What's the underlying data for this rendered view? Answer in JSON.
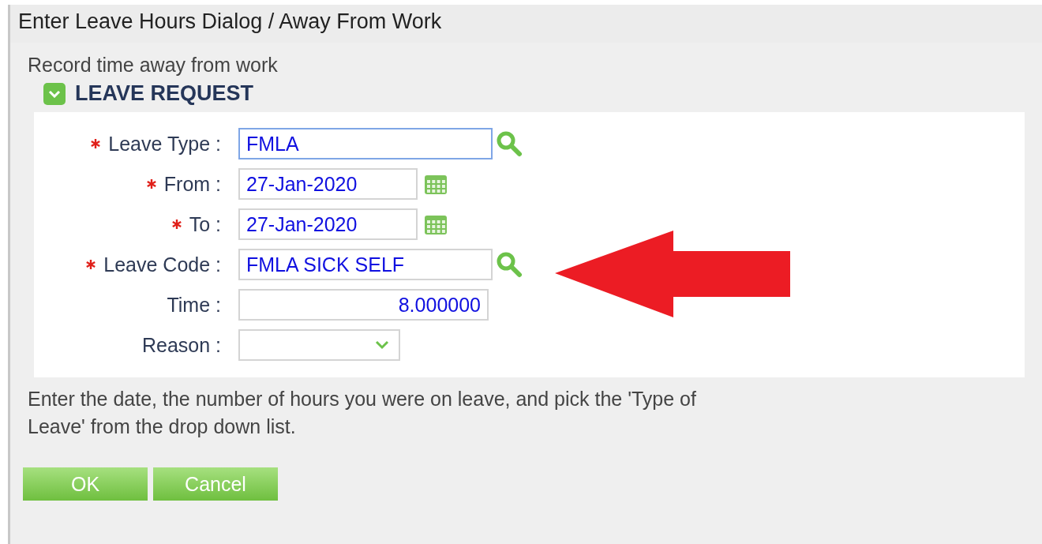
{
  "window": {
    "title": "Enter Leave Hours Dialog / Away From Work"
  },
  "subtitle": "Record time away from work",
  "section": {
    "title": "LEAVE REQUEST",
    "expanded": true
  },
  "fields": [
    {
      "label": "Leave Type :",
      "value": "FMLA",
      "required": true,
      "kind": "lookup",
      "focused": true
    },
    {
      "label": "From :",
      "value": "27-Jan-2020",
      "required": true,
      "kind": "date",
      "focused": false
    },
    {
      "label": "To :",
      "value": "27-Jan-2020",
      "required": true,
      "kind": "date",
      "focused": false
    },
    {
      "label": "Leave Code :",
      "value": "FMLA SICK SELF",
      "required": true,
      "kind": "lookup",
      "focused": false
    },
    {
      "label": "Time :",
      "value": "8.000000",
      "required": false,
      "kind": "number",
      "focused": false
    },
    {
      "label": "Reason :",
      "required": false,
      "kind": "select",
      "focused": false
    }
  ],
  "help": "Enter the date, the number of hours you were on leave, and pick the 'Type of Leave' from the drop down list.",
  "buttons": [
    "OK",
    "Cancel"
  ]
}
